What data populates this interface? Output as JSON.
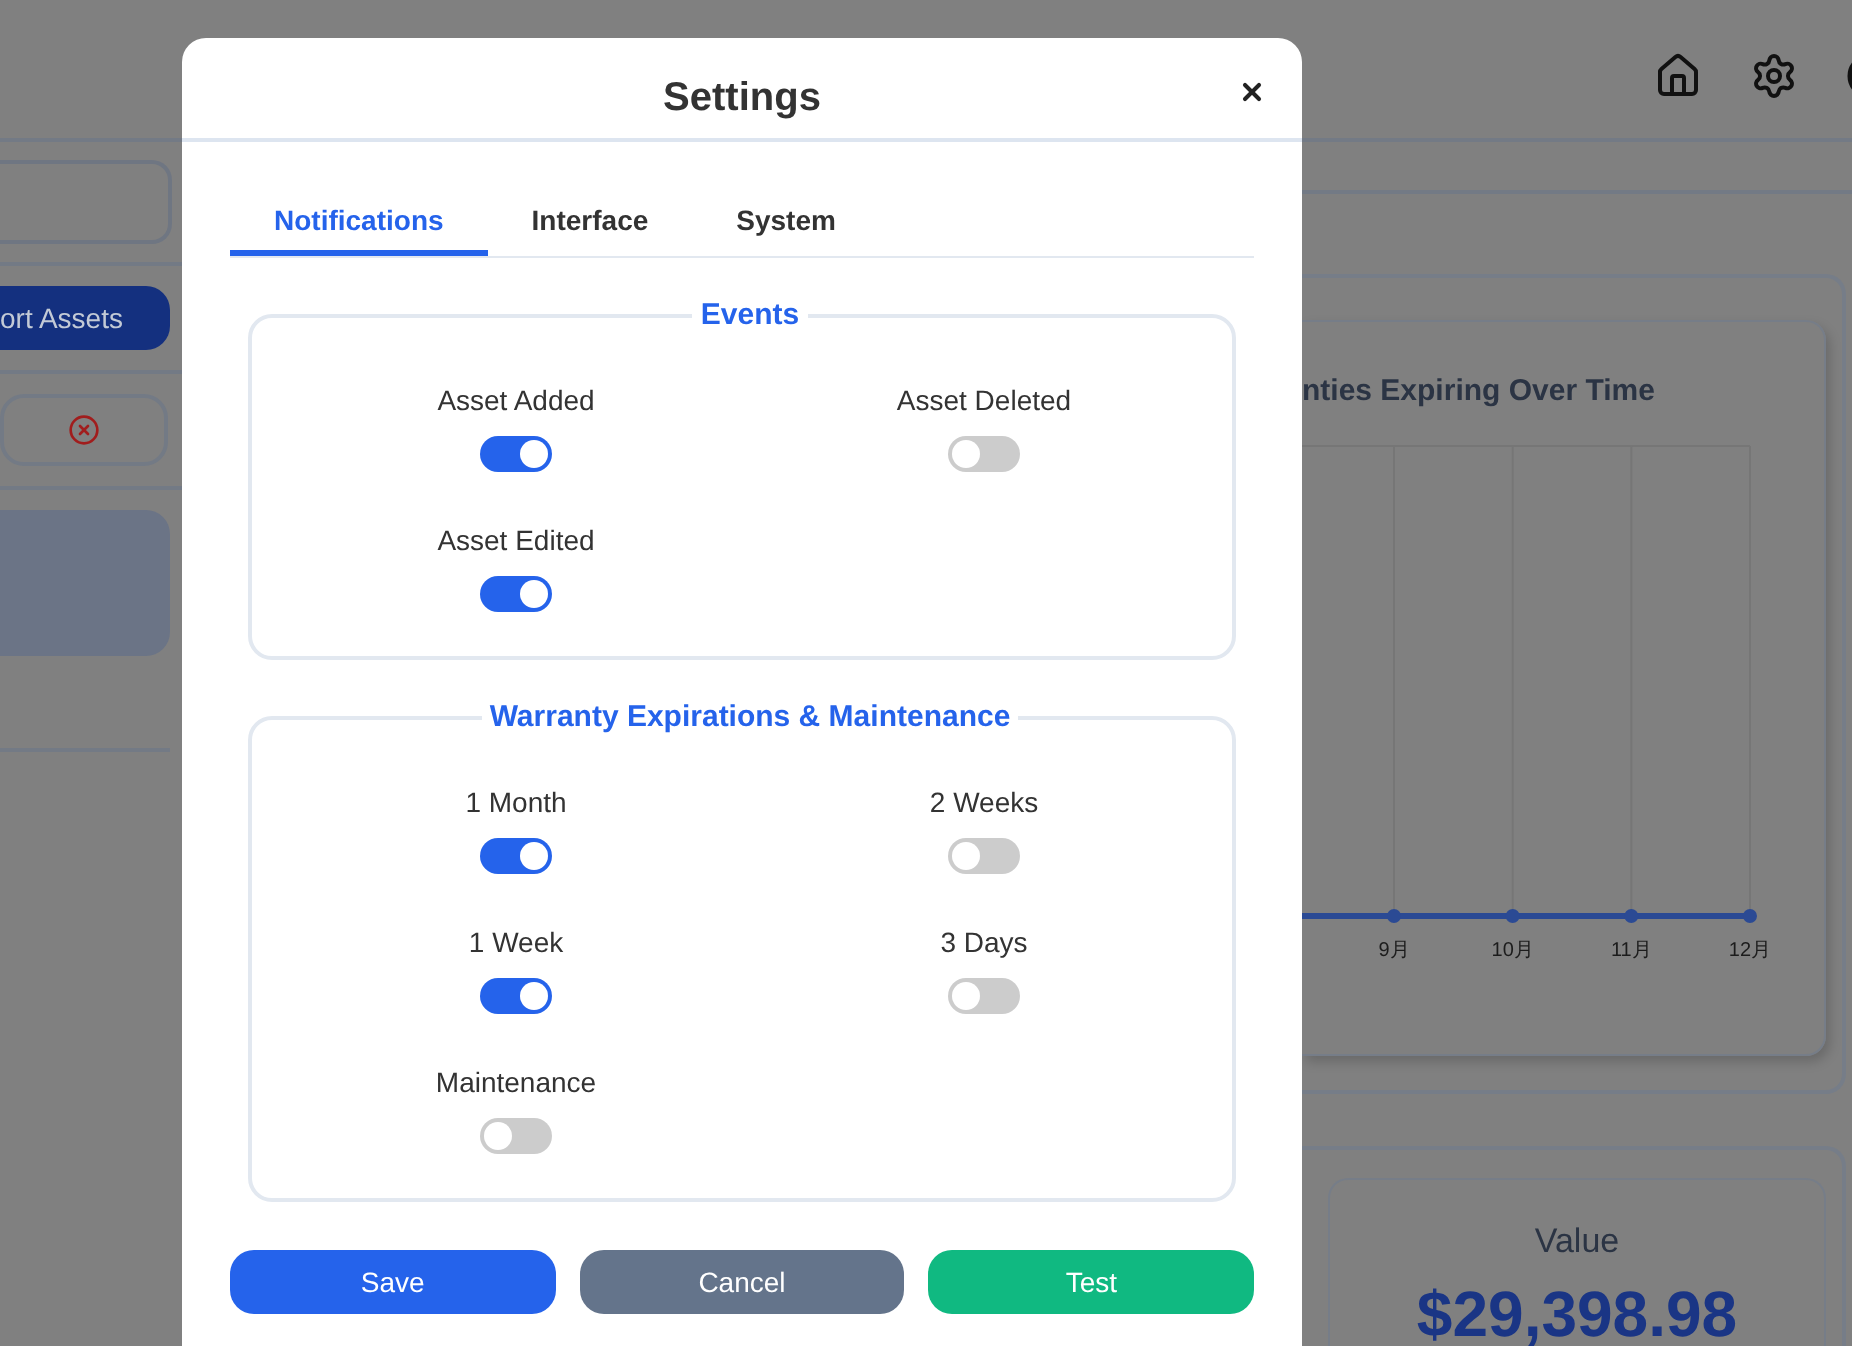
{
  "background": {
    "assets_button": "ort Assets",
    "chart": {
      "title": "nties Expiring Over Time",
      "axis_labels": [
        "9月",
        "10月",
        "11月",
        "12月"
      ]
    },
    "value_card": {
      "label": "Value",
      "value": "$29,398.98"
    }
  },
  "dialog": {
    "title": "Settings",
    "tabs": [
      {
        "label": "Notifications",
        "selected": true
      },
      {
        "label": "Interface",
        "selected": false
      },
      {
        "label": "System",
        "selected": false
      }
    ],
    "sections": [
      {
        "title": "Events",
        "items": [
          {
            "label": "Asset Added",
            "on": true
          },
          {
            "label": "Asset Deleted",
            "on": false
          },
          {
            "label": "Asset Edited",
            "on": true
          }
        ]
      },
      {
        "title": "Warranty Expirations & Maintenance",
        "items": [
          {
            "label": "1 Month",
            "on": true
          },
          {
            "label": "2 Weeks",
            "on": false
          },
          {
            "label": "1 Week",
            "on": true
          },
          {
            "label": "3 Days",
            "on": false
          },
          {
            "label": "Maintenance",
            "on": false
          }
        ]
      }
    ],
    "buttons": [
      {
        "label": "Save",
        "kind": "save"
      },
      {
        "label": "Cancel",
        "kind": "cancel"
      },
      {
        "label": "Test",
        "kind": "test"
      }
    ]
  }
}
